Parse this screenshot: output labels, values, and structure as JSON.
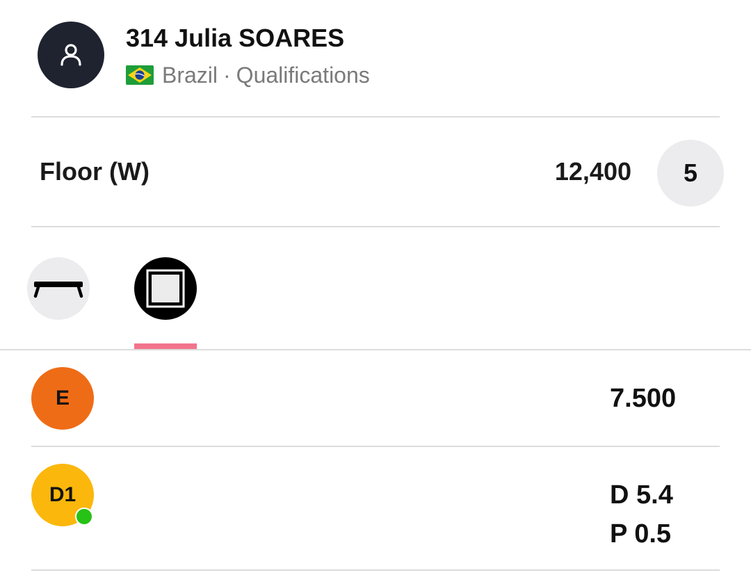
{
  "athlete": {
    "name": "314 Julia SOARES",
    "country": "Brazil",
    "separator": "·",
    "phase": "Qualifications"
  },
  "apparatus_row": {
    "label": "Floor (W)",
    "score": "12,400",
    "rank": "5"
  },
  "apparatus_tabs": [
    {
      "name": "balance-beam-icon",
      "active": false
    },
    {
      "name": "floor-exercise-icon",
      "active": true
    }
  ],
  "judges": [
    {
      "badge": "E",
      "color": "#ef6c16",
      "scores": [
        "7.500"
      ]
    },
    {
      "badge": "D1",
      "color": "#fbb70b",
      "online": true,
      "scores": [
        "D 5.4",
        "P 0.5"
      ]
    }
  ],
  "colors": {
    "avatar_bg": "#1f2330",
    "tab_indicator": "#f2748c",
    "online_dot": "#27c216"
  }
}
